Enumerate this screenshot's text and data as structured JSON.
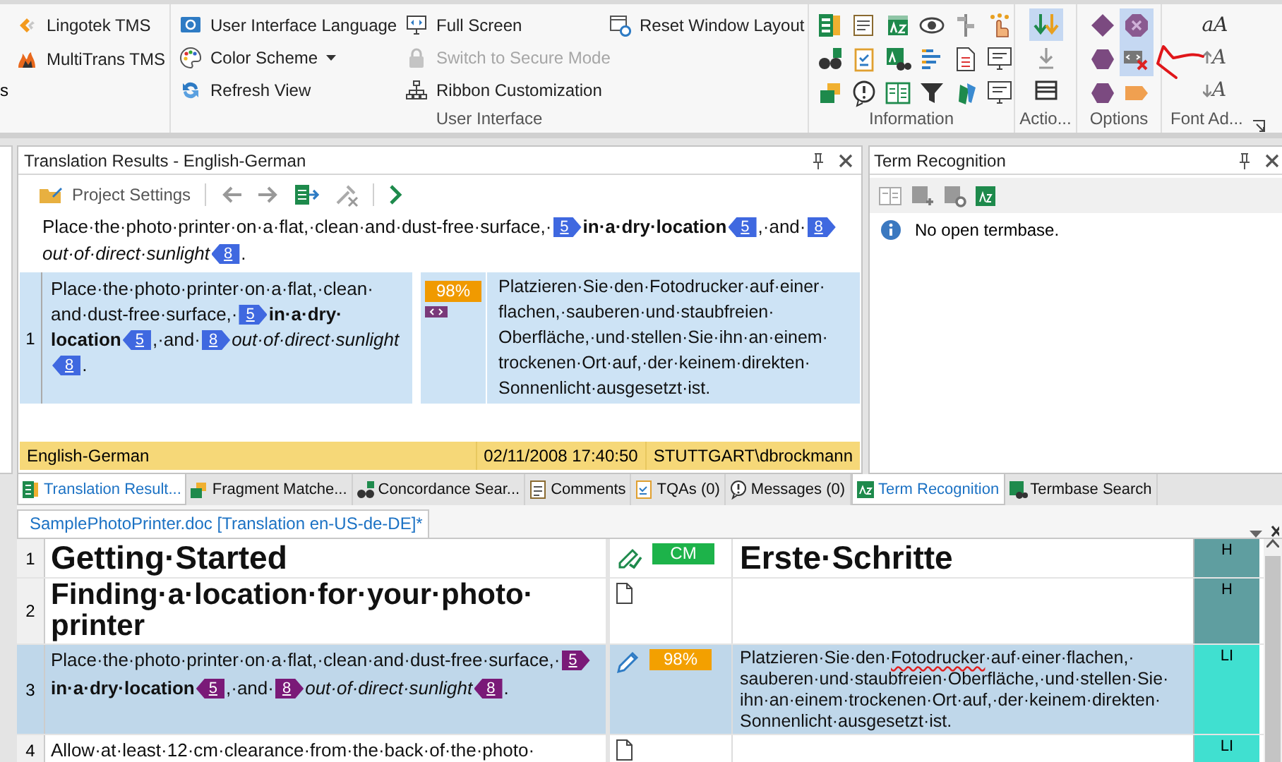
{
  "ribbon": {
    "left_group": {
      "cut_text": "s",
      "items": [
        {
          "label": "Lingotek TMS"
        },
        {
          "label": "MultiTrans TMS"
        }
      ]
    },
    "user_interface": {
      "label": "User Interface",
      "columns": [
        [
          {
            "label": "User Interface Language",
            "disabled": false,
            "dropdown": false
          },
          {
            "label": "Color Scheme",
            "disabled": false,
            "dropdown": true
          },
          {
            "label": "Refresh View",
            "disabled": false,
            "dropdown": false
          }
        ],
        [
          {
            "label": "Full Screen",
            "disabled": false,
            "dropdown": false
          },
          {
            "label": "Switch to Secure Mode",
            "disabled": true,
            "dropdown": false
          },
          {
            "label": "Ribbon Customization",
            "disabled": false,
            "dropdown": false
          }
        ],
        [
          {
            "label": "Reset Window Layout",
            "disabled": false,
            "dropdown": false
          }
        ]
      ]
    },
    "information": {
      "label": "Information"
    },
    "actions": {
      "label": "Actio...",
      "buttons": [
        {
          "on": true
        },
        {
          "on": false
        },
        {
          "on": false
        }
      ]
    },
    "options": {
      "label": "Options",
      "buttons": [
        {
          "on": false
        },
        {
          "on": true
        },
        {
          "on": false
        },
        {
          "on": true
        },
        {
          "on": false
        },
        {
          "on": false
        }
      ]
    },
    "font_adjust": {
      "label": "Font Ad...",
      "buttons": [
        {
          "text": "aA"
        },
        {
          "text": "A"
        },
        {
          "text": "A"
        }
      ]
    }
  },
  "translation_results": {
    "title": "Translation Results - English-German",
    "toolbar": {
      "project_settings": "Project Settings"
    },
    "source_preview": [
      {
        "kind": "text",
        "text": "Place·the·photo·printer·on·a·flat,·clean·and·dust-free·surface,·"
      },
      {
        "kind": "tag_open",
        "text": "5"
      },
      {
        "kind": "bold",
        "text": "in·a·dry·location"
      },
      {
        "kind": "tag_close",
        "text": "5"
      },
      {
        "kind": "text",
        "text": ",·and·"
      },
      {
        "kind": "tag_open",
        "text": "8"
      },
      {
        "kind": "italic",
        "text": "out·of·direct·sunlight"
      },
      {
        "kind": "tag_close",
        "text": "8"
      },
      {
        "kind": "text",
        "text": "."
      }
    ],
    "results": [
      {
        "number": "1",
        "selected": true,
        "score": "98%",
        "source": [
          {
            "kind": "text",
            "text": "Place·the·photo·printer·on·a·flat,·clean·"
          },
          {
            "kind": "text",
            "text": "and·dust-free·surface,·"
          },
          {
            "kind": "tag_open",
            "text": "5"
          },
          {
            "kind": "bold",
            "text": "in·a·dry·location"
          },
          {
            "kind": "tag_close",
            "text": "5"
          },
          {
            "kind": "text",
            "text": ",·and·"
          },
          {
            "kind": "tag_open",
            "text": "8"
          },
          {
            "kind": "italic",
            "text": "out·of·direct·sunlight"
          },
          {
            "kind": "tag_close",
            "text": "8"
          },
          {
            "kind": "text",
            "text": "."
          }
        ],
        "target": "Platzieren·Sie·den·Fotodrucker·auf·einer·flachen,·sauberen·und·staubfreien·Oberfläche,·und·stellen·Sie·ihn·an·einem·trockenen·Ort·auf,·der·keinem·direkten·Sonnenlicht·ausgesetzt·ist."
      }
    ],
    "status_bar": {
      "language_pair": "English-German",
      "date": "02/11/2008 17:40:50",
      "user": "STUTTGART\\dbrockmann"
    }
  },
  "term_recognition": {
    "title": "Term Recognition",
    "message": "No open termbase."
  },
  "bottom_tabs_left": [
    {
      "label": "Translation Result...",
      "selected": true
    },
    {
      "label": "Fragment Matche...",
      "selected": false
    },
    {
      "label": "Concordance Sear...",
      "selected": false
    },
    {
      "label": "Comments",
      "selected": false
    },
    {
      "label": "TQAs (0)",
      "selected": false
    },
    {
      "label": "Messages (0)",
      "selected": false
    }
  ],
  "bottom_tabs_right": [
    {
      "label": "Term Recognition",
      "selected": true
    },
    {
      "label": "Termbase Search",
      "selected": false
    }
  ],
  "editor": {
    "document_tab": {
      "label": "SamplePhotoPrinter.doc [Translation en-US-de-DE]*",
      "selected": true
    },
    "rows": [
      {
        "number": "1",
        "kind": "heading1",
        "selected": false,
        "status_icon": {
          "kind": "confirmed"
        },
        "match": {
          "kind": "context",
          "text": "CM"
        },
        "source": [
          {
            "kind": "text",
            "text": "Getting·Started"
          }
        ],
        "target": [
          {
            "kind": "text",
            "text": "Erste·Schritte"
          }
        ],
        "style": {
          "text": "H",
          "color": "#5f9ea0"
        }
      },
      {
        "number": "2",
        "kind": "heading2",
        "selected": false,
        "status_icon": {
          "kind": "new"
        },
        "source": [
          {
            "kind": "text",
            "text": "Finding·a·location·for·your·photo·printer"
          }
        ],
        "style": {
          "text": "H",
          "color": "#5f9ea0"
        }
      },
      {
        "number": "3",
        "kind": "body",
        "selected": true,
        "status_icon": {
          "kind": "edited"
        },
        "match": {
          "kind": "fuzzy",
          "text": "98%"
        },
        "source": [
          {
            "kind": "text",
            "text": "Place·the·photo·printer·on·a·flat,·clean·and·dust-free·surface,·"
          },
          {
            "kind": "tag_open",
            "text": "5"
          },
          {
            "kind": "bold",
            "text": "in·a·dry·location"
          },
          {
            "kind": "tag_close",
            "text": "5"
          },
          {
            "kind": "text",
            "text": ",·and·"
          },
          {
            "kind": "tag_open",
            "text": "8"
          },
          {
            "kind": "italic",
            "text": "out·of·direct·sunlight"
          },
          {
            "kind": "tag_close",
            "text": "8"
          },
          {
            "kind": "text",
            "text": "."
          }
        ],
        "target": [
          {
            "kind": "text",
            "text": "Platzieren·Sie·den·"
          },
          {
            "kind": "misspelled",
            "text": "Fotodrucker"
          },
          {
            "kind": "text",
            "text": "·auf·einer·flachen,·sauberen·und·staubfreien·Oberfläche,·und·stellen·Sie·ihn·an·einem·trockenen·Ort·auf,·der·keinem·direkten·Sonnenlicht·ausgesetzt·ist."
          }
        ],
        "style": {
          "text": "LI",
          "color": "#40e0d0"
        }
      },
      {
        "number": "4",
        "kind": "body",
        "selected": false,
        "status_icon": {
          "kind": "new"
        },
        "source": [
          {
            "kind": "text",
            "text": "Allow·at·least·12·cm·clearance·from·the·back·of·the·photo·"
          }
        ],
        "style": {
          "text": "LI",
          "color": "#40e0d0"
        }
      }
    ]
  }
}
